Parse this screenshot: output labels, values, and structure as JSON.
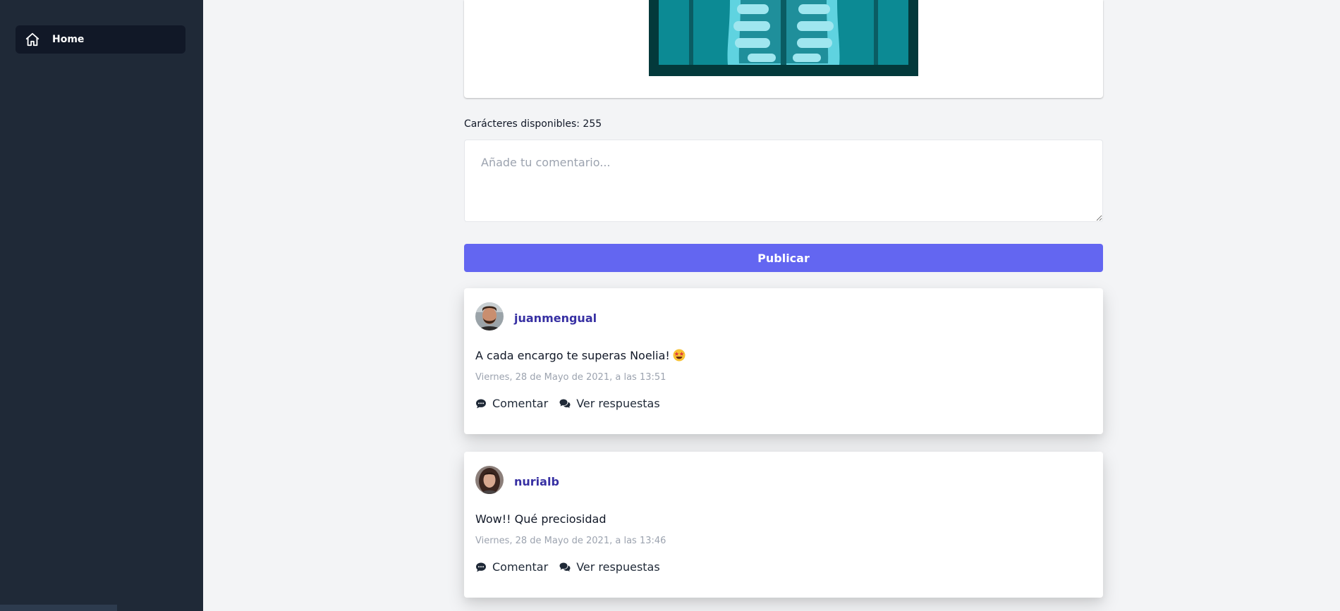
{
  "sidebar": {
    "items": [
      {
        "label": "Home",
        "icon": "home-icon"
      }
    ]
  },
  "composer": {
    "chars_label": "Carácteres disponibles: 255",
    "placeholder": "Añade tu comentario...",
    "publish_label": "Publicar"
  },
  "colors": {
    "sidebar_bg": "#1f2937",
    "accent": "#6366f1",
    "username": "#3730a3"
  },
  "comments": [
    {
      "username": "juanmengual",
      "text": "A cada encargo te superas Noelia!",
      "emoji": "star-struck-emoji",
      "timestamp": "Viernes, 28 de Mayo de 2021, a las 13:51",
      "actions": {
        "comment": "Comentar",
        "replies": "Ver respuestas"
      }
    },
    {
      "username": "nurialb",
      "text": "Wow!! Qué preciosidad",
      "timestamp": "Viernes, 28 de Mayo de 2021, a las 13:46",
      "actions": {
        "comment": "Comentar",
        "replies": "Ver respuestas"
      }
    }
  ]
}
